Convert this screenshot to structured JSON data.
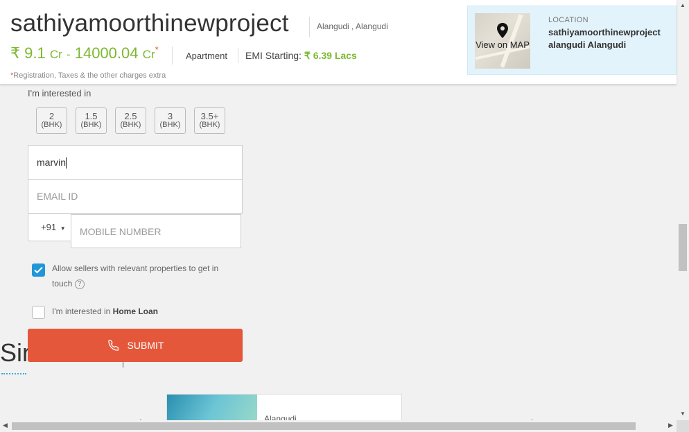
{
  "header": {
    "title": "sathiyamoorthinewproject",
    "location": "Alangudi , Alangudi",
    "price": {
      "currency": "₹",
      "min": "9.1",
      "min_unit": "Cr",
      "dash": "-",
      "max": "14000.04",
      "max_unit": "Cr",
      "star": "*"
    },
    "type": "Apartment",
    "emi_label": "EMI Starting:",
    "emi_value": "₹ 6.39 Lacs",
    "note_star": "*",
    "note": "Registration, Taxes & the other charges extra"
  },
  "location_card": {
    "map_label": "View on MAP",
    "label": "LOCATION",
    "line1": "sathiyamoorthinewproject",
    "line2": "alangudi Alangudi"
  },
  "form": {
    "interest_label": "I'm interested in",
    "bhk_options": [
      {
        "value": "2",
        "unit": "(BHK)"
      },
      {
        "value": "1.5",
        "unit": "(BHK)"
      },
      {
        "value": "2.5",
        "unit": "(BHK)"
      },
      {
        "value": "3",
        "unit": "(BHK)"
      },
      {
        "value": "3.5+",
        "unit": "(BHK)"
      }
    ],
    "name_value": "marvin",
    "email_placeholder": "EMAIL ID",
    "country_code": "+91",
    "mobile_placeholder": "MOBILE NUMBER",
    "allow_sellers_text": "Allow sellers with relevant properties to get in touch",
    "allow_sellers_checked": true,
    "help_symbol": "?",
    "home_loan_prefix": "I'm interested in ",
    "home_loan_bold": "Home Loan",
    "home_loan_checked": false,
    "submit_label": "SUBMIT"
  },
  "similar": {
    "title_visible": "Sir",
    "card_text": "Alangudi"
  },
  "colors": {
    "accent_green": "#7cb82f",
    "submit_red": "#e4573a",
    "checkbox_blue": "#2196d8",
    "location_bg": "#e3f3fb"
  }
}
